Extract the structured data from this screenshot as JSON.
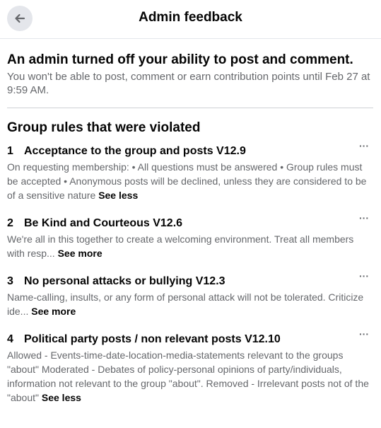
{
  "header": {
    "title": "Admin feedback",
    "back_icon": "arrow-left-icon"
  },
  "notice": {
    "title": "An admin turned off your ability to post and comment.",
    "body": "You won't be able to post, comment or earn contribution points until Feb 27 at 9:59 AM."
  },
  "rules_section": {
    "heading": "Group rules that were violated",
    "more_icon": "more-options-icon",
    "more_glyph": "···",
    "rules": [
      {
        "number": "1",
        "title": "Acceptance to the group and posts V12.9",
        "description": "On requesting membership: • All questions must be answered • Group rules must be accepted • Anonymous posts will be declined, unless they are considered to be of a sensitive nature",
        "toggle": "See less"
      },
      {
        "number": "2",
        "title": "Be Kind and Courteous V12.6",
        "description": "We're all in this together to create a welcoming environment. Treat all members with resp...",
        "toggle": "See more"
      },
      {
        "number": "3",
        "title": "No personal attacks or bullying V12.3",
        "description": "Name-calling, insults, or any form of personal attack will not be tolerated. Criticize ide...",
        "toggle": "See more"
      },
      {
        "number": "4",
        "title": "Political party posts / non relevant posts V12.10",
        "description": "Allowed - Events-time-date-location-media-statements relevant to the groups \"about\" Moderated - Debates of policy-personal opinions of party/individuals, information not relevant to the group \"about\". Removed - Irrelevant posts not of the \"about\"",
        "toggle": "See less"
      }
    ]
  }
}
